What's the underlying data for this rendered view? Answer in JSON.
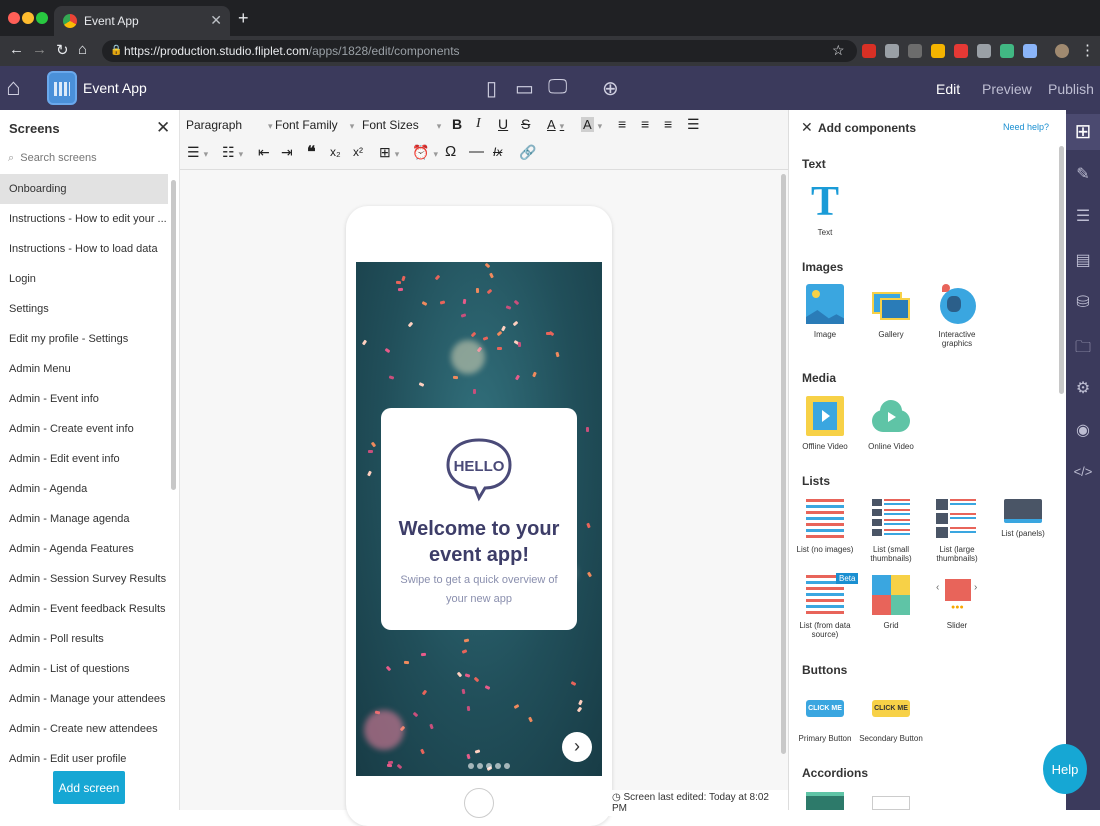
{
  "browser": {
    "tab_title": "Event App",
    "url_host": "https://production.studio.fliplet.com",
    "url_path": "/apps/1828/edit/components"
  },
  "header": {
    "app_name": "Event App",
    "nav": {
      "edit": "Edit",
      "preview": "Preview",
      "publish": "Publish"
    }
  },
  "screens": {
    "title": "Screens",
    "search_placeholder": "Search screens",
    "items": [
      "Onboarding",
      "Instructions - How to edit your ...",
      "Instructions - How to load data",
      "Login",
      "Settings",
      "Edit my profile - Settings",
      "Admin Menu",
      "Admin - Event info",
      "Admin - Create event info",
      "Admin - Edit event info",
      "Admin - Agenda",
      "Admin - Manage agenda",
      "Admin - Agenda Features",
      "Admin - Session Survey Results",
      "Admin - Event feedback Results",
      "Admin - Poll results",
      "Admin - List of questions",
      "Admin - Manage your attendees",
      "Admin - Create new attendees",
      "Admin - Edit user profile"
    ],
    "add_button": "Add screen"
  },
  "toolbar": {
    "paragraph": "Paragraph",
    "font_family": "Font Family",
    "font_sizes": "Font Sizes",
    "bold": "B",
    "italic": "I",
    "underline": "U",
    "strike": "S",
    "text_color": "A",
    "bg_color": "A",
    "quote": "❝",
    "subscript": "x₂",
    "superscript": "x²",
    "omega": "Ω",
    "clear": "Ix"
  },
  "phone": {
    "welcome": "Welcome to your event app!",
    "subtitle": "Swipe to get a quick overview of your new app",
    "hello": "HELLO",
    "last_edited": "Screen last edited: Today at 8:02 PM"
  },
  "components": {
    "title": "Add components",
    "help_link": "Need help?",
    "sections": {
      "text": "Text",
      "images": "Images",
      "media": "Media",
      "lists": "Lists",
      "buttons": "Buttons",
      "accordions": "Accordions"
    },
    "items": {
      "text": "Text",
      "image": "Image",
      "gallery": "Gallery",
      "interactive": "Interactive graphics",
      "offline_video": "Offline Video",
      "online_video": "Online Video",
      "list_no_images": "List (no images)",
      "list_small": "List (small thumbnails)",
      "list_large": "List (large thumbnails)",
      "list_panels": "List (panels)",
      "list_data": "List (from data source)",
      "grid": "Grid",
      "slider": "Slider",
      "primary_button": "Primary Button",
      "secondary_button": "Secondary Button",
      "beta": "Beta",
      "click_me": "CLICK ME"
    }
  },
  "help_button": "Help",
  "colors": {
    "header_bg": "#3b3a5c",
    "accent": "#16a7d4",
    "text_icon": "#1a9bd7"
  }
}
